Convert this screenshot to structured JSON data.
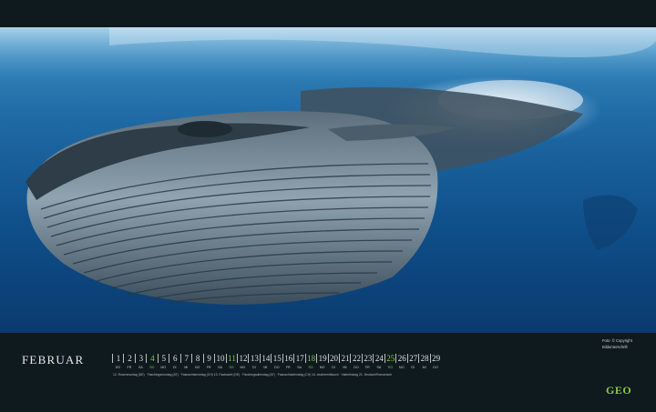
{
  "calendar": {
    "month": "FEBRUAR",
    "days": [
      {
        "n": "1",
        "d": "DO",
        "sun": false
      },
      {
        "n": "2",
        "d": "FR",
        "sun": false
      },
      {
        "n": "3",
        "d": "SA",
        "sun": false
      },
      {
        "n": "4",
        "d": "SO",
        "sun": true
      },
      {
        "n": "5",
        "d": "MO",
        "sun": false
      },
      {
        "n": "6",
        "d": "DI",
        "sun": false
      },
      {
        "n": "7",
        "d": "MI",
        "sun": false
      },
      {
        "n": "8",
        "d": "DO",
        "sun": false
      },
      {
        "n": "9",
        "d": "FR",
        "sun": false
      },
      {
        "n": "10",
        "d": "SA",
        "sun": false
      },
      {
        "n": "11",
        "d": "SO",
        "sun": true
      },
      {
        "n": "12",
        "d": "MO",
        "sun": false
      },
      {
        "n": "13",
        "d": "DI",
        "sun": false
      },
      {
        "n": "14",
        "d": "MI",
        "sun": false
      },
      {
        "n": "15",
        "d": "DO",
        "sun": false
      },
      {
        "n": "16",
        "d": "FR",
        "sun": false
      },
      {
        "n": "17",
        "d": "SA",
        "sun": false
      },
      {
        "n": "18",
        "d": "SO",
        "sun": true
      },
      {
        "n": "19",
        "d": "MO",
        "sun": false
      },
      {
        "n": "20",
        "d": "DI",
        "sun": false
      },
      {
        "n": "21",
        "d": "MI",
        "sun": false
      },
      {
        "n": "22",
        "d": "DO",
        "sun": false
      },
      {
        "n": "23",
        "d": "FR",
        "sun": false
      },
      {
        "n": "24",
        "d": "SA",
        "sun": false
      },
      {
        "n": "25",
        "d": "SO",
        "sun": true
      },
      {
        "n": "26",
        "d": "MO",
        "sun": false
      },
      {
        "n": "27",
        "d": "DI",
        "sun": false
      },
      {
        "n": "28",
        "d": "MI",
        "sun": false
      },
      {
        "n": "29",
        "d": "DO",
        "sun": false
      }
    ],
    "holidays": "12. Rosenmontag (DE) · Faschingsmontag (AT) · Fasnachtsmontag (CH)   13. Fastnacht (DE) · Faschingsdienstag (AT) · Fasnachtsdienstag (CH)   14. Aschermittwoch · Valentinstag   21. Deutsch/Romanisch"
  },
  "credit": {
    "line1": "Foto: © Copyright",
    "line2": "Bildunterschrift"
  },
  "brand": {
    "logo": "GEO",
    "accent_color": "#8dc63f"
  }
}
